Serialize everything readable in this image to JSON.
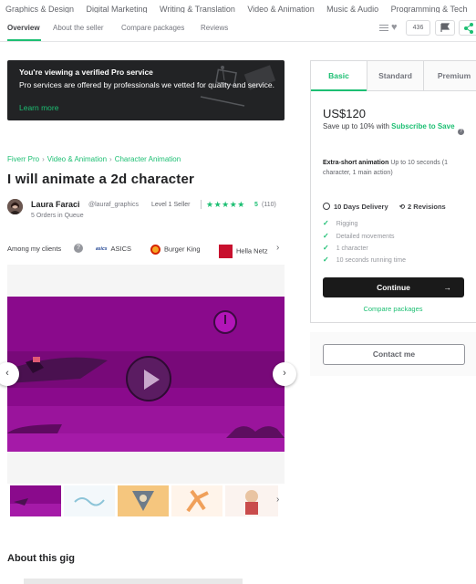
{
  "categories": [
    "Graphics & Design",
    "Digital Marketing",
    "Writing & Translation",
    "Video & Animation",
    "Music & Audio",
    "Programming & Tech"
  ],
  "subnav": {
    "tabs": [
      "Overview",
      "About the seller",
      "Compare packages",
      "Reviews"
    ],
    "save_count": "436"
  },
  "banner": {
    "title": "You're viewing a verified Pro service",
    "text": "Pro services are offered by professionals we vetted for quality and service.",
    "link": "Learn more"
  },
  "breadcrumb": [
    "Fiverr Pro",
    "Video & Animation",
    "Character Animation"
  ],
  "gig_title": "I will animate a 2d character",
  "seller": {
    "name": "Laura Faraci",
    "handle": "@lauraf_graphics",
    "level": "Level 1 Seller",
    "stars": "★★★★★",
    "rating": "5",
    "reviews": "(110)",
    "queue": "5 Orders in Queue"
  },
  "clients": {
    "label": "Among my clients",
    "items": [
      "ASICS",
      "Burger King",
      "Hella Netz"
    ]
  },
  "about_heading": "About this gig",
  "pricing": {
    "tabs": [
      "Basic",
      "Standard",
      "Premium"
    ],
    "price": "US$120",
    "save_text": "Save up to 10% with",
    "save_link": "Subscribe to Save",
    "desc_title": "Extra-short animation",
    "desc_text": "Up to 10 seconds (1 character, 1 main action)",
    "delivery": "10 Days Delivery",
    "revisions": "2 Revisions",
    "features": [
      "Rigging",
      "Detailed movements",
      "1 character",
      "10 seconds running time"
    ],
    "continue": "Continue",
    "compare": "Compare packages",
    "contact": "Contact me"
  },
  "colors": {
    "brand": "#1dbf73",
    "video_bg": "#8a0a8c",
    "dark": "#222325"
  }
}
